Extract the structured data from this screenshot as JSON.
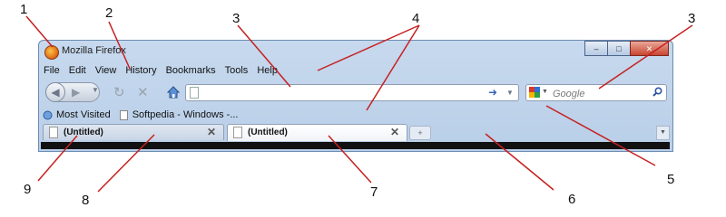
{
  "window": {
    "title": "Mozilla Firefox"
  },
  "caption_buttons": {
    "minimize": "–",
    "maximize": "□",
    "close": "✕"
  },
  "menubar": {
    "items": [
      {
        "label": "File"
      },
      {
        "label": "Edit"
      },
      {
        "label": "View"
      },
      {
        "label": "History"
      },
      {
        "label": "Bookmarks"
      },
      {
        "label": "Tools"
      },
      {
        "label": "Help"
      }
    ]
  },
  "navbar": {
    "url_value": "",
    "search_placeholder": "Google",
    "search_engine_icon": "google-icon"
  },
  "bookmarks": {
    "items": [
      {
        "label": "Most Visited",
        "icon": "bookmark-star-icon"
      },
      {
        "label": "Softpedia - Windows -...",
        "icon": "page-icon"
      }
    ]
  },
  "tabs": [
    {
      "label": "(Untitled)",
      "state": "inactive"
    },
    {
      "label": "(Untitled)",
      "state": "active"
    }
  ],
  "callouts": [
    "1",
    "2",
    "3",
    "3",
    "4",
    "5",
    "6",
    "7",
    "8",
    "9"
  ],
  "colors": {
    "frame": "#b9cfe8",
    "accent": "#3b66b4",
    "close_button": "#c9452f"
  }
}
